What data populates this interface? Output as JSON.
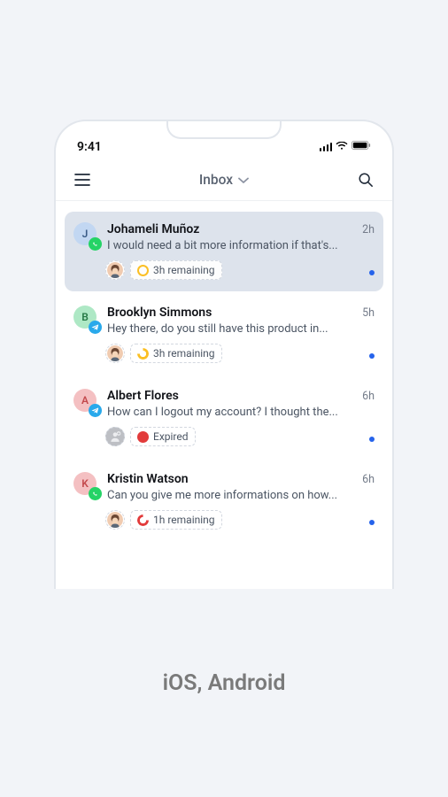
{
  "statusBar": {
    "time": "9:41"
  },
  "header": {
    "title": "Inbox"
  },
  "conversations": [
    {
      "name": "Johameli Muñoz",
      "initial": "J",
      "preview": "I would need a bit more information if that's...",
      "time": "2h",
      "timer": "3h remaining",
      "avatarColor": "blue",
      "channel": "whatsapp",
      "agentAssigned": true,
      "selected": true,
      "unread": true,
      "timerState": "full"
    },
    {
      "name": "Brooklyn Simmons",
      "initial": "B",
      "preview": "Hey there, do you still have this product in...",
      "time": "5h",
      "timer": "3h remaining",
      "avatarColor": "green",
      "channel": "telegram",
      "agentAssigned": true,
      "selected": false,
      "unread": true,
      "timerState": "three-quarter"
    },
    {
      "name": "Albert Flores",
      "initial": "A",
      "preview": "How can I logout my account? I thought the...",
      "time": "6h",
      "timer": "Expired",
      "avatarColor": "pink",
      "channel": "telegram",
      "agentAssigned": false,
      "selected": false,
      "unread": true,
      "timerState": "expired"
    },
    {
      "name": "Kristin Watson",
      "initial": "K",
      "preview": "Can you give me more informations on how...",
      "time": "6h",
      "timer": "1h remaining",
      "avatarColor": "pink",
      "channel": "whatsapp",
      "agentAssigned": true,
      "selected": false,
      "unread": true,
      "timerState": "quarter"
    }
  ],
  "caption": "iOS, Android"
}
